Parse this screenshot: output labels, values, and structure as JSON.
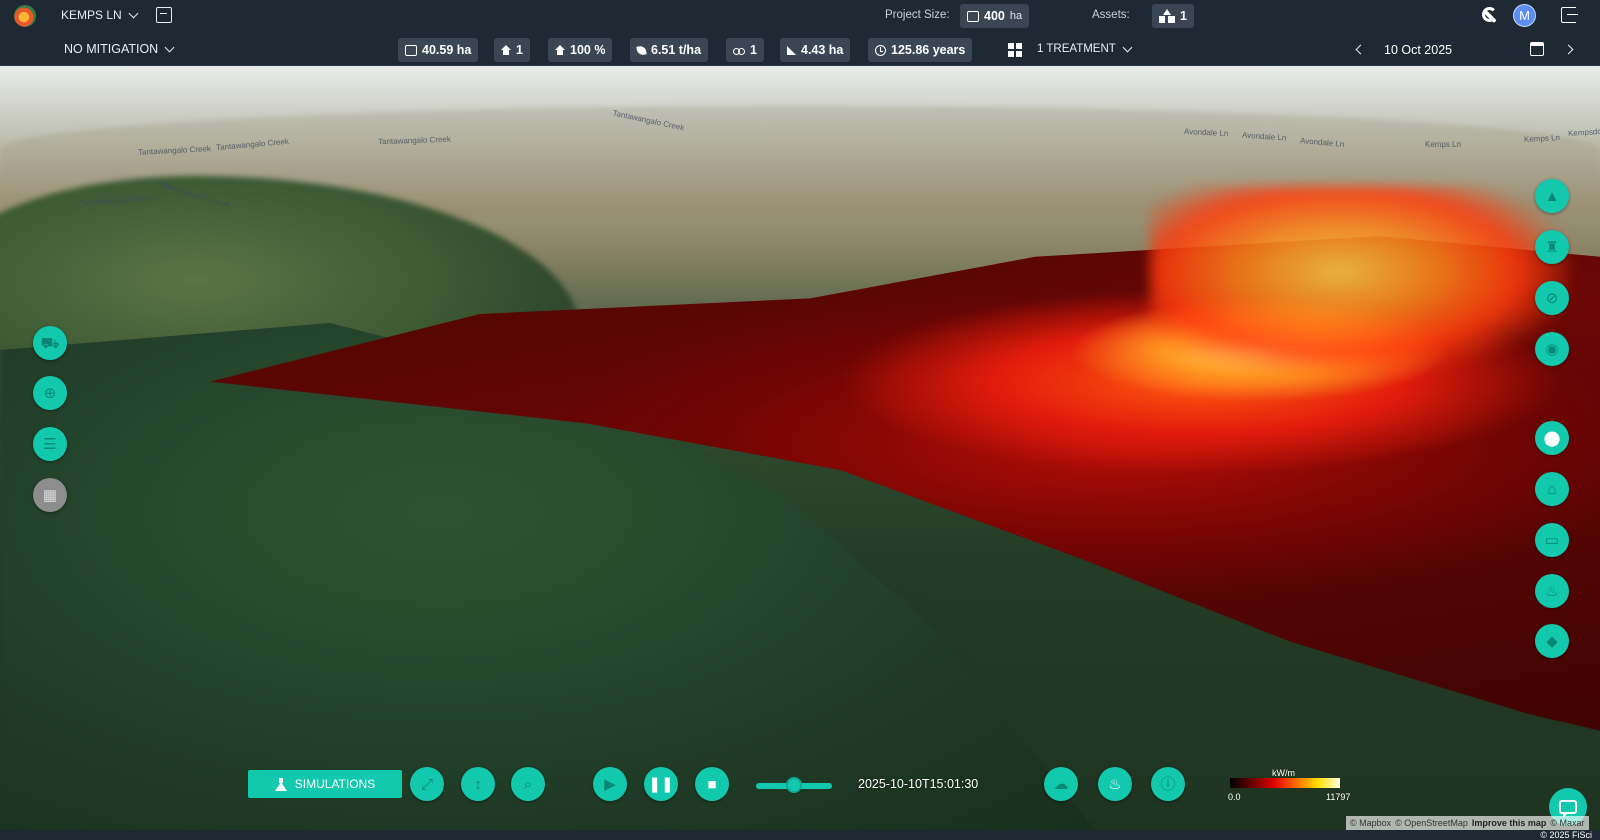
{
  "header": {
    "project_name": "KEMPS LN",
    "project_size_label": "Project Size:",
    "project_size_value": "400",
    "project_size_unit": "ha",
    "assets_label": "Assets:",
    "assets_value": "1",
    "avatar_initial": "M"
  },
  "subbar": {
    "mitigation": "NO MITIGATION",
    "stats": [
      {
        "icon": "area-icon",
        "value": "40.59 ha"
      },
      {
        "icon": "house-icon",
        "value": "1"
      },
      {
        "icon": "house-percent-icon",
        "value": "100 %"
      },
      {
        "icon": "fuel-load-icon",
        "value": "6.51 t/ha"
      },
      {
        "icon": "vehicle-icon",
        "value": "1"
      },
      {
        "icon": "slope-area-icon",
        "value": "4.43 ha"
      },
      {
        "icon": "clock-icon",
        "value": "125.86 years"
      }
    ],
    "treatment": "1 TREATMENT",
    "date": "10 Oct 2025"
  },
  "map_labels": [
    "Tantawangalo Creek",
    "Tantawangalo Creek",
    "Tantawangalo Creek",
    "Tantawangalo Creek",
    "Tantawangalo Creek",
    "Tantawangalo Creek",
    "Avondale Ln",
    "Avondale Ln",
    "Avondale Ln",
    "Kemps Ln",
    "Kemps Ln",
    "Kempsdo"
  ],
  "playback": {
    "simulations_label": "SIMULATIONS",
    "timestamp": "2025-10-10T15:01:30",
    "progress": 0.5
  },
  "legend": {
    "unit": "kW/m",
    "min": "0.0",
    "max": "11797",
    "colors": [
      "#000000",
      "#6a0000",
      "#e00000",
      "#ff6a00",
      "#ffe000",
      "#ffffe0"
    ]
  },
  "attribution": {
    "mapbox": "© Mapbox",
    "osm": "© OpenStreetMap",
    "improve": "Improve this map",
    "maxar": "© Maxar"
  },
  "copyright": "© 2025 FiSci",
  "colors": {
    "accent": "#12c9ae",
    "bar_bg": "#1f2933",
    "pill_bg": "#3a4653"
  }
}
